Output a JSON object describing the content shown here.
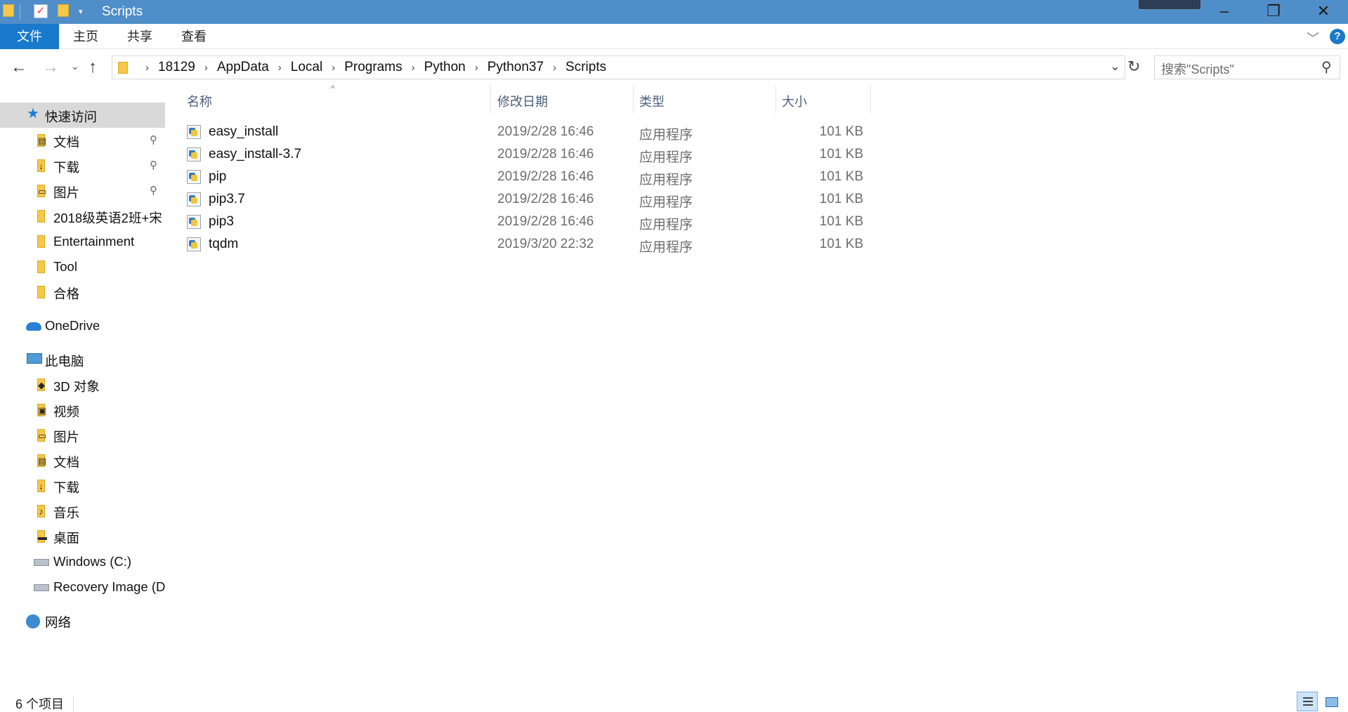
{
  "window": {
    "title": "Scripts",
    "min_icon": "minimize-icon",
    "max_icon": "restore-icon",
    "close_icon": "close-icon"
  },
  "ribbon": {
    "tabs": [
      {
        "label": "文件",
        "active": true
      },
      {
        "label": "主页"
      },
      {
        "label": "共享"
      },
      {
        "label": "查看"
      }
    ]
  },
  "address": {
    "crumbs": [
      "18129",
      "AppData",
      "Local",
      "Programs",
      "Python",
      "Python37",
      "Scripts"
    ],
    "separator": "›",
    "search_placeholder": "搜索\"Scripts\""
  },
  "nav": {
    "quick_access": "快速访问",
    "quick_items": [
      {
        "label": "文档",
        "pinned": true,
        "icon": "documents-folder-icon"
      },
      {
        "label": "下载",
        "pinned": true,
        "icon": "downloads-folder-icon"
      },
      {
        "label": "图片",
        "pinned": true,
        "icon": "pictures-folder-icon"
      },
      {
        "label": "2018级英语2班+宋",
        "pinned": false,
        "icon": "folder-icon"
      },
      {
        "label": "Entertainment",
        "pinned": false,
        "icon": "folder-icon"
      },
      {
        "label": "Tool",
        "pinned": false,
        "icon": "folder-icon"
      },
      {
        "label": "合格",
        "pinned": false,
        "icon": "folder-icon"
      }
    ],
    "onedrive": "OneDrive",
    "this_pc": "此电脑",
    "pc_items": [
      {
        "label": "3D 对象",
        "icon": "3d-objects-folder-icon"
      },
      {
        "label": "视频",
        "icon": "videos-folder-icon"
      },
      {
        "label": "图片",
        "icon": "pictures-folder-icon"
      },
      {
        "label": "文档",
        "icon": "documents-folder-icon"
      },
      {
        "label": "下载",
        "icon": "downloads-folder-icon"
      },
      {
        "label": "音乐",
        "icon": "music-folder-icon"
      },
      {
        "label": "桌面",
        "icon": "desktop-folder-icon"
      },
      {
        "label": "Windows (C:)",
        "icon": "windows-drive-icon"
      },
      {
        "label": "Recovery Image (D",
        "icon": "drive-icon"
      }
    ],
    "network": "网络"
  },
  "table": {
    "columns": {
      "name": "名称",
      "date": "修改日期",
      "type": "类型",
      "size": "大小"
    },
    "rows": [
      {
        "name": "easy_install",
        "date": "2019/2/28 16:46",
        "type": "应用程序",
        "size": "101 KB"
      },
      {
        "name": "easy_install-3.7",
        "date": "2019/2/28 16:46",
        "type": "应用程序",
        "size": "101 KB"
      },
      {
        "name": "pip",
        "date": "2019/2/28 16:46",
        "type": "应用程序",
        "size": "101 KB"
      },
      {
        "name": "pip3.7",
        "date": "2019/2/28 16:46",
        "type": "应用程序",
        "size": "101 KB"
      },
      {
        "name": "pip3",
        "date": "2019/2/28 16:46",
        "type": "应用程序",
        "size": "101 KB"
      },
      {
        "name": "tqdm",
        "date": "2019/3/20 22:32",
        "type": "应用程序",
        "size": "101 KB"
      }
    ]
  },
  "status": {
    "count": "6 个项目"
  },
  "colors": {
    "titlebar": "#4f8ec8",
    "file_tab": "#1979ca",
    "selection": "#d9d9d9"
  }
}
